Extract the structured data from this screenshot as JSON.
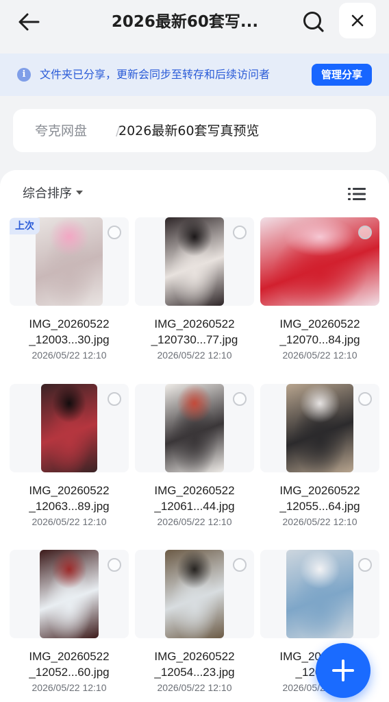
{
  "header": {
    "title": "2026最新60套写...",
    "back_icon": "arrow-left-icon",
    "search_icon": "search-icon",
    "close_icon": "close-icon"
  },
  "banner": {
    "icon": "info-icon",
    "icon_glyph": "i",
    "text": "文件夹已分享，更新会同步至转存和后续访问者",
    "button": "管理分享",
    "accent": "#1866ff"
  },
  "breadcrumb": {
    "root": "夸克网盘",
    "separator": "/",
    "current": "2026最新60套写真预览"
  },
  "toolbar": {
    "sort_label": "综合排序",
    "view_icon": "list-view-icon"
  },
  "files": [
    {
      "name1": "IMG_20260522",
      "name2": "_12003...30.jpg",
      "date": "2026/05/22 12:10",
      "badge": "上次",
      "palette": [
        "#e9e4e2",
        "#c9b8b8",
        "#f2a7c4"
      ]
    },
    {
      "name1": "IMG_20260522",
      "name2": "_120730...77.jpg",
      "date": "2026/05/22 12:10",
      "palette": [
        "#2e2628",
        "#e8e2de",
        "#1b1718"
      ]
    },
    {
      "name1": "IMG_20260522",
      "name2": "_12070...84.jpg",
      "date": "2026/05/22 12:10",
      "palette": [
        "#f1dfe6",
        "#d2202e",
        "#f6c8d4"
      ]
    },
    {
      "name1": "IMG_20260522",
      "name2": "_12063...89.jpg",
      "date": "2026/05/22 12:10",
      "palette": [
        "#3a2325",
        "#b5363f",
        "#120d0e"
      ]
    },
    {
      "name1": "IMG_20260522",
      "name2": "_12061...44.jpg",
      "date": "2026/05/22 12:10",
      "palette": [
        "#efece8",
        "#3a3638",
        "#c44a3a"
      ]
    },
    {
      "name1": "IMG_20260522",
      "name2": "_12055...64.jpg",
      "date": "2026/05/22 12:10",
      "palette": [
        "#b8a58f",
        "#2b2a2c",
        "#e6e3e2"
      ]
    },
    {
      "name1": "IMG_20260522",
      "name2": "_12052...60.jpg",
      "date": "2026/05/22 12:10",
      "palette": [
        "#3c1a1a",
        "#e9eef2",
        "#9c2a2a"
      ]
    },
    {
      "name1": "IMG_20260522",
      "name2": "_12054...23.jpg",
      "date": "2026/05/22 12:10",
      "palette": [
        "#6b5a45",
        "#d8dde0",
        "#262320"
      ]
    },
    {
      "name1": "IMG_20260522",
      "name2": "_12051...",
      "date": "2026/05/22 12:10",
      "palette": [
        "#cdd6de",
        "#7ea6c8",
        "#f2f2f4"
      ]
    }
  ],
  "fab": {
    "icon": "plus-icon"
  }
}
